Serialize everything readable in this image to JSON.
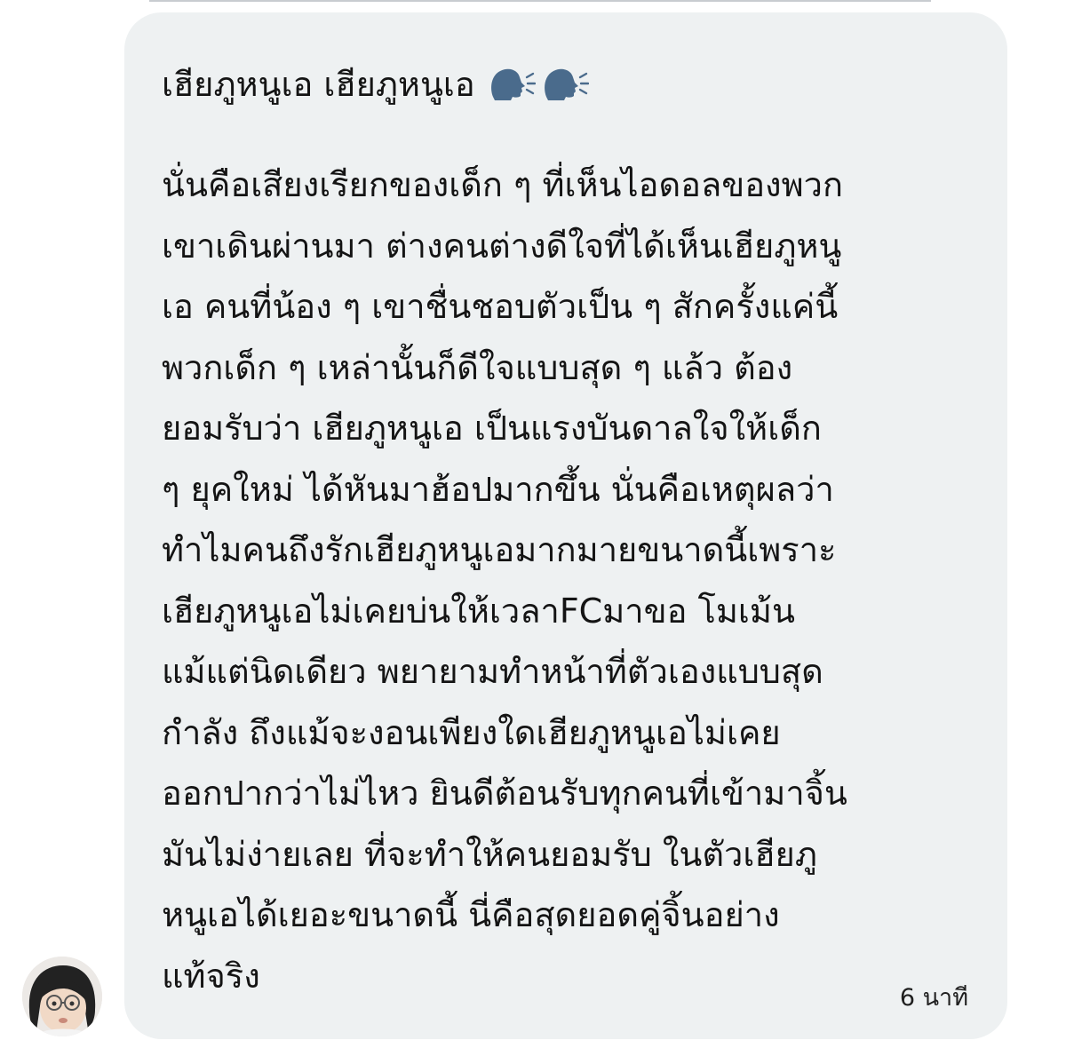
{
  "comment": {
    "title": "เฮียภูหนูเอ เฮียภูหนูเอ",
    "emojis": [
      "speaking-head",
      "speaking-head"
    ],
    "body_lines": [
      "นั่นคือเสียงเรียกของเด็ก ๆ ที่เห็นไอดอลของพวก",
      "เขาเดินผ่านมา ต่างคนต่างดีใจที่ได้เห็นเฮียภูหนู",
      "เอ คนที่น้อง ๆ เขาชื่นชอบตัวเป็น ๆ สักครั้งแค่นี้",
      "พวกเด็ก ๆ เหล่านั้นก็ดีใจแบบสุด ๆ แล้ว ต้อง",
      "ยอมรับว่า เฮียภูหนูเอ เป็นแรงบันดาลใจให้เด็ก",
      "ๆ ยุคใหม่ ได้หันมาฮ้อปมากขึ้น นั่นคือเหตุผลว่า",
      "ทำไมคนถึงรักเฮียภูหนูเอมากมายขนาดนี้เพราะ",
      "เฮียภูหนูเอไม่เคยบ่นให้เวลาFCมาขอ โมเม้น",
      "แม้แต่นิดเดียว พยายามทำหน้าที่ตัวเองแบบสุด",
      "กำลัง ถึงแม้จะงอนเพียงใดเฮียภูหนูเอไม่เคย",
      "ออกปากว่าไม่ไหว ยินดีต้อนรับทุกคนที่เข้ามาจิ้น",
      "มันไม่ง่ายเลย ที่จะทำให้คนยอมรับ ในตัวเฮียภู",
      "หนูเอได้เยอะขนาดนี้ นี่คือสุดยอดคู่จิ้นอย่าง",
      "แท้จริง"
    ],
    "timestamp": "6 นาที"
  },
  "colors": {
    "bubble_bg": "#eef1f2",
    "text": "#141414",
    "emoji_blue": "#4a6b8c"
  }
}
